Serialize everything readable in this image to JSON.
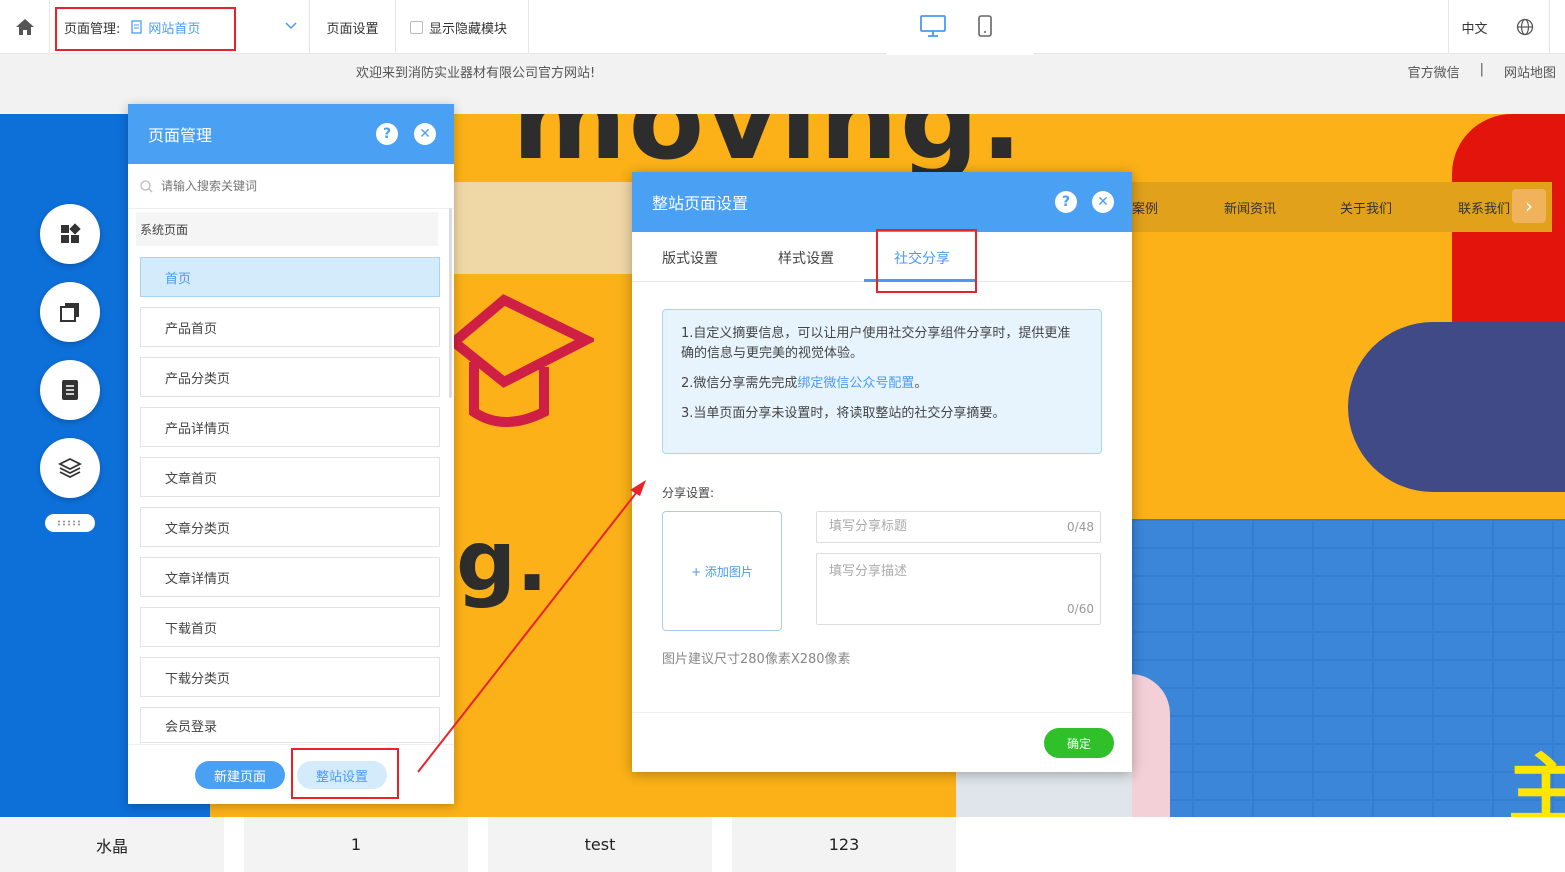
{
  "toolbar": {
    "page_mgmt_label": "页面管理:",
    "current_page": "网站首页",
    "page_settings": "页面设置",
    "show_hidden": "显示隐藏模块",
    "lang": "中文"
  },
  "site": {
    "welcome": "欢迎来到消防实业器材有限公司官方网站!",
    "links": [
      "官方微信",
      "|",
      "网站地图"
    ],
    "nav": [
      "案例",
      "新闻资讯",
      "关于我们",
      "联系我们"
    ],
    "colors": {
      "accent": "#4aa0f2",
      "ok": "#2fc02a",
      "highlight": "#e8232a",
      "bg_yellow": "#fbb117",
      "bg_blue": "#0d6fd8"
    }
  },
  "pm_panel": {
    "title": "页面管理",
    "search_placeholder": "请输入搜索关键词",
    "section": "系统页面",
    "items": [
      "首页",
      "产品首页",
      "产品分类页",
      "产品详情页",
      "文章首页",
      "文章分类页",
      "文章详情页",
      "下载首页",
      "下载分类页",
      "会员登录"
    ],
    "new_page": "新建页面",
    "site_settings": "整站设置"
  },
  "modal": {
    "title": "整站页面设置",
    "tabs": [
      "版式设置",
      "样式设置",
      "社交分享"
    ],
    "info1": "1.自定义摘要信息，可以让用户使用社交分享组件分享时，提供更准确的信息与更完美的视觉体验。",
    "info2_prefix": "2.微信分享需先完成",
    "info2_link": "绑定微信公众号配置",
    "info2_suffix": "。",
    "info3": "3.当单页面分享未设置时，将读取整站的社交分享摘要。",
    "share_label": "分享设置:",
    "add_image": "+ 添加图片",
    "title_placeholder": "填写分享标题",
    "title_count": "0/48",
    "desc_placeholder": "填写分享描述",
    "desc_count": "0/60",
    "hint": "图片建议尺寸280像素X280像素",
    "ok": "确定"
  },
  "bottom": [
    "水晶",
    "1",
    "test",
    "123"
  ]
}
